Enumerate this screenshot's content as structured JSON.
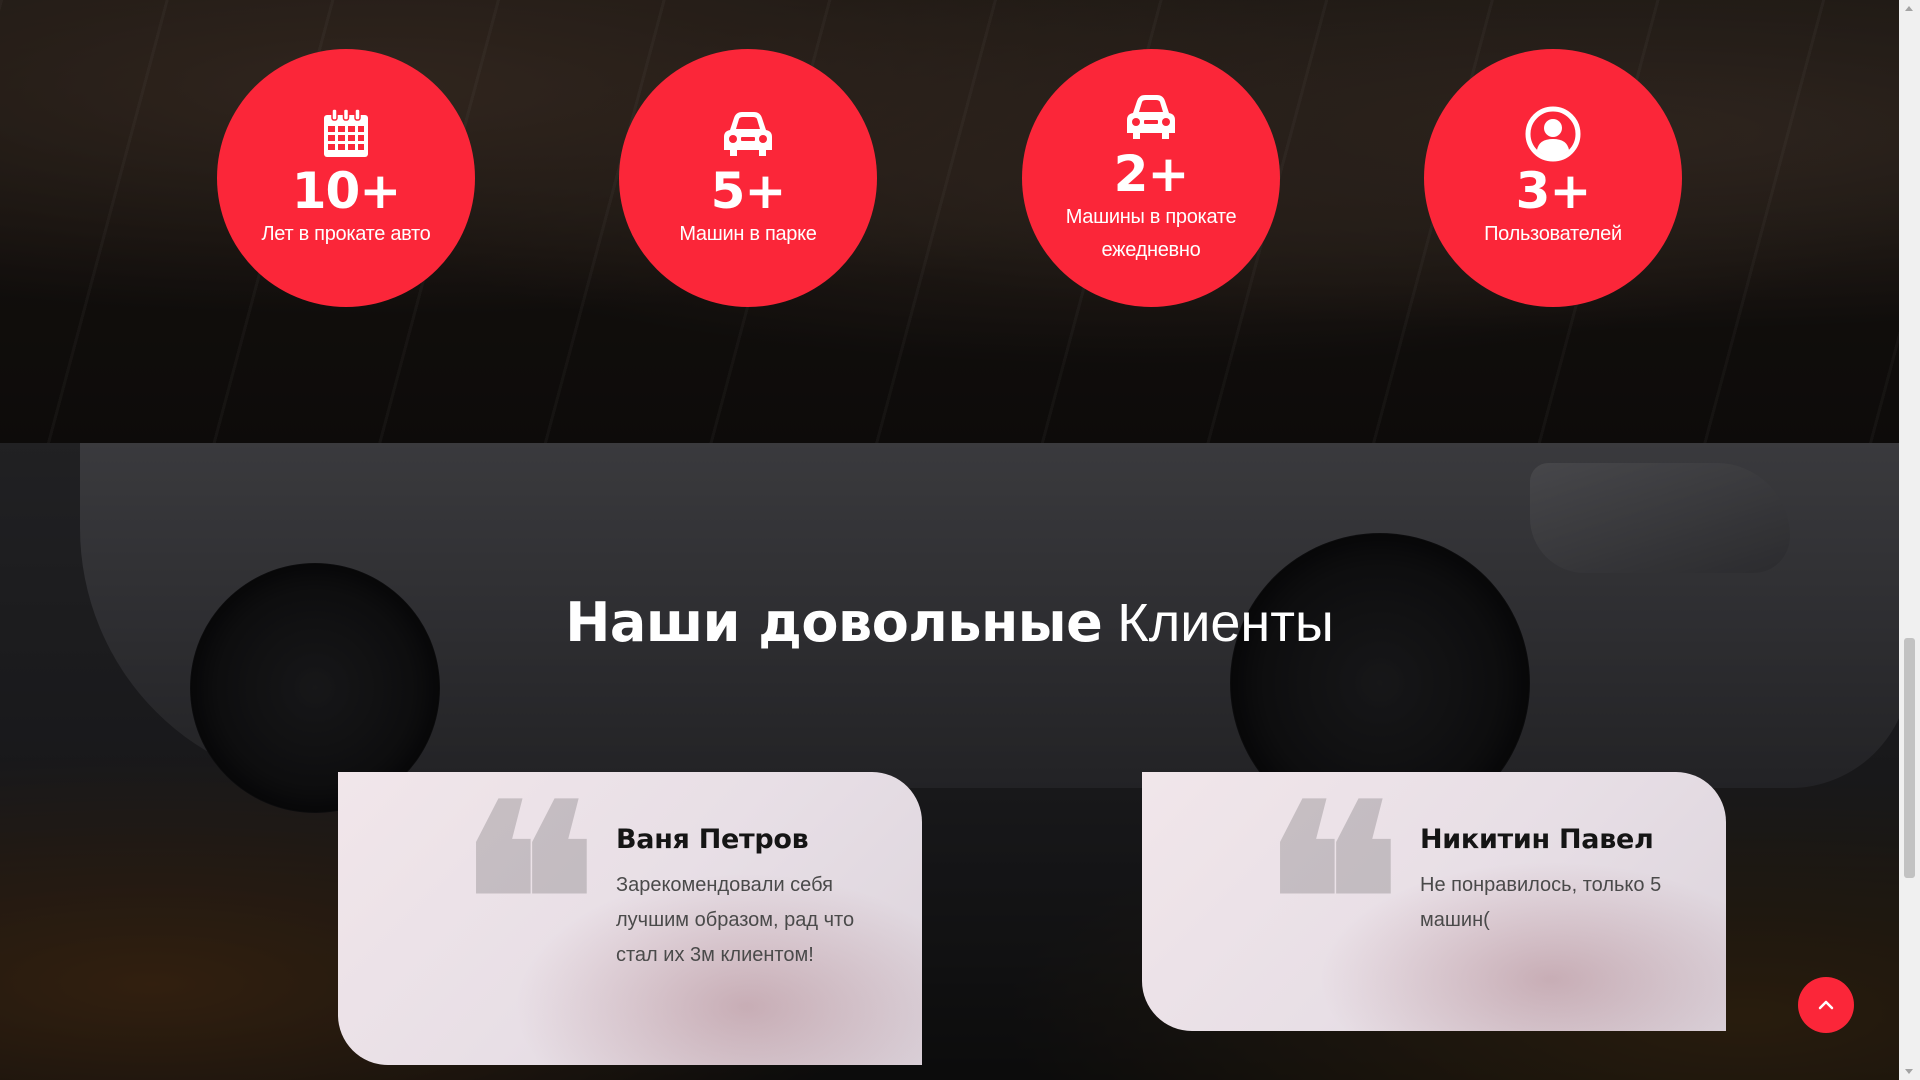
{
  "stats": [
    {
      "icon": "calendar-icon",
      "number": "10+",
      "label": "Лет в прокате авто"
    },
    {
      "icon": "car-icon",
      "number": "5+",
      "label": "Машин в парке"
    },
    {
      "icon": "car-icon",
      "number": "2+",
      "label": "Машины в прокате ежедневно"
    },
    {
      "icon": "user-circle-icon",
      "number": "3+",
      "label": "Пользователей"
    }
  ],
  "clients": {
    "title_bold": "Наши довольные",
    "title_light": "Клиенты",
    "testimonials": [
      {
        "name": "Ваня Петров",
        "text": "Зарекомендовали себя лучшим образом, рад что стал их 3м клиентом!"
      },
      {
        "name": "Никитин Павел",
        "text": "Не понравилось, только 5 машин("
      }
    ]
  },
  "scroll_top_icon": "chevron-up-icon",
  "colors": {
    "accent": "#fb2639"
  }
}
